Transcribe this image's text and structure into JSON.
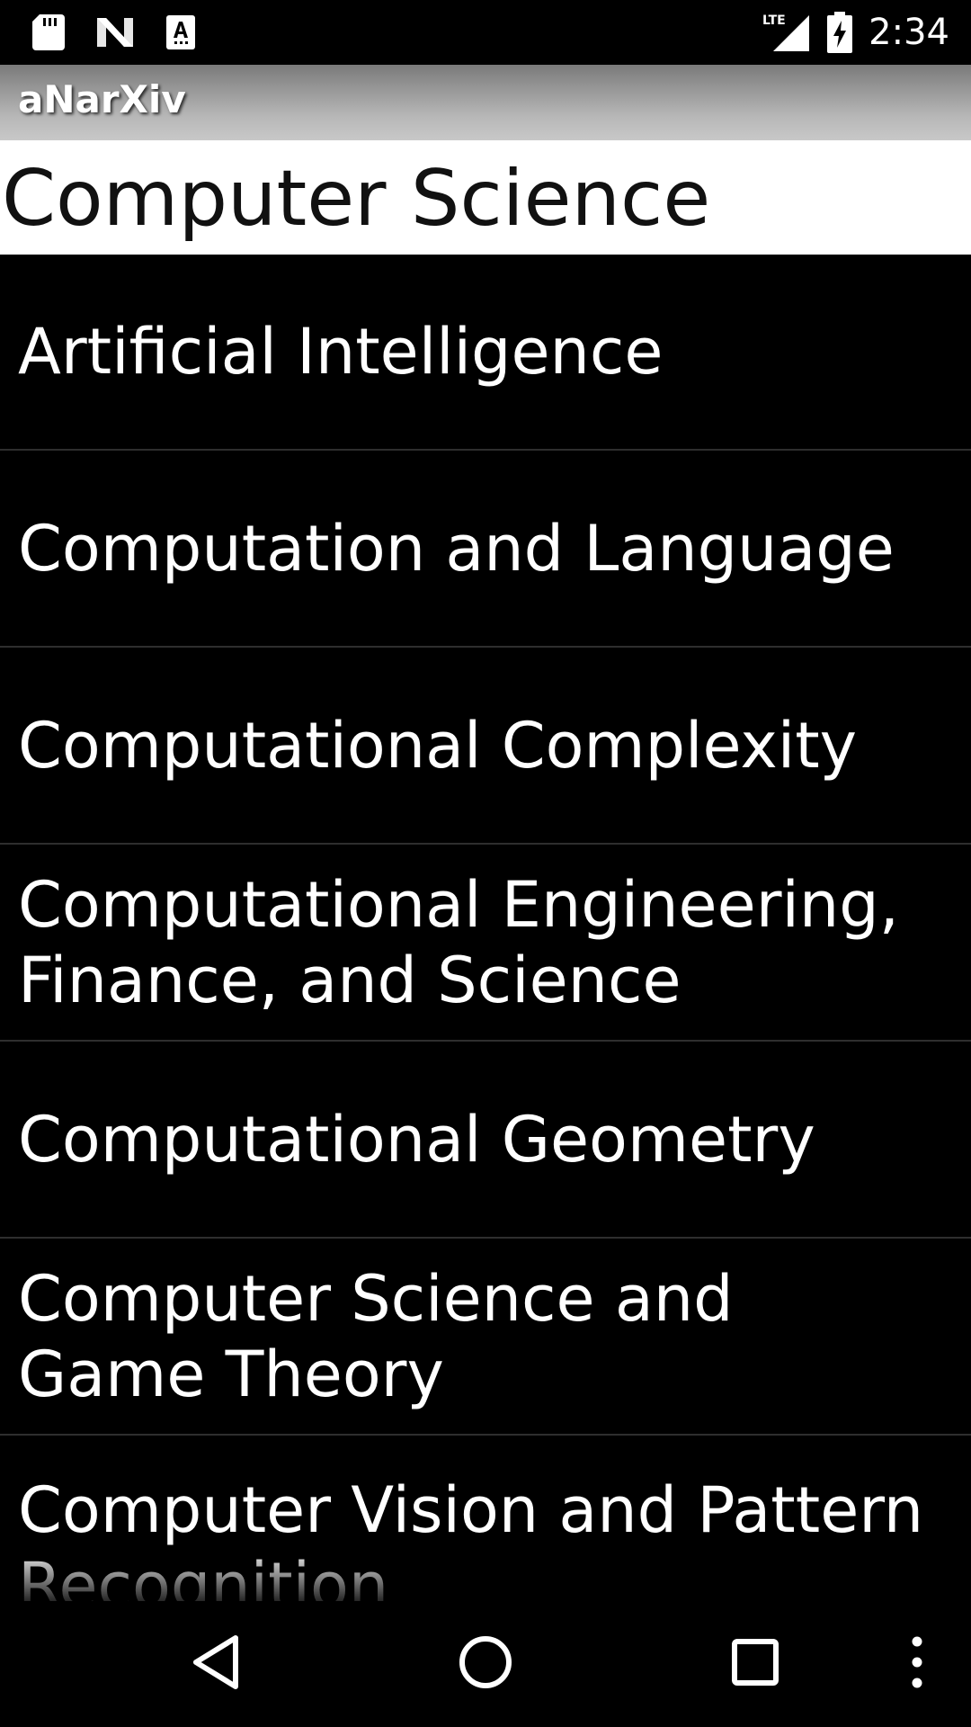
{
  "status_bar": {
    "time": "2:34",
    "left_icons": [
      "sd-card-icon",
      "n-notification-icon",
      "keyboard-a-icon"
    ],
    "right_icons": [
      "lte-signal-icon",
      "battery-charging-icon"
    ],
    "network_label": "LTE"
  },
  "app_bar": {
    "title": "aNarXiv"
  },
  "section": {
    "title": "Computer Science"
  },
  "categories": [
    {
      "label": "Artificial Intelligence"
    },
    {
      "label": "Computation and Language"
    },
    {
      "label": "Computational Complexity"
    },
    {
      "label": "Computational Engineering, Finance, and Science"
    },
    {
      "label": "Computational Geometry"
    },
    {
      "label": "Computer Science and Game Theory"
    },
    {
      "label": "Computer Vision and Pattern Recognition"
    }
  ],
  "nav_bar": {
    "buttons": [
      "back-icon",
      "home-icon",
      "recents-icon",
      "overflow-menu-icon"
    ]
  },
  "colors": {
    "background": "#000000",
    "section_header_bg": "#ffffff",
    "text": "#ffffff",
    "divider": "#2e2e2e"
  }
}
